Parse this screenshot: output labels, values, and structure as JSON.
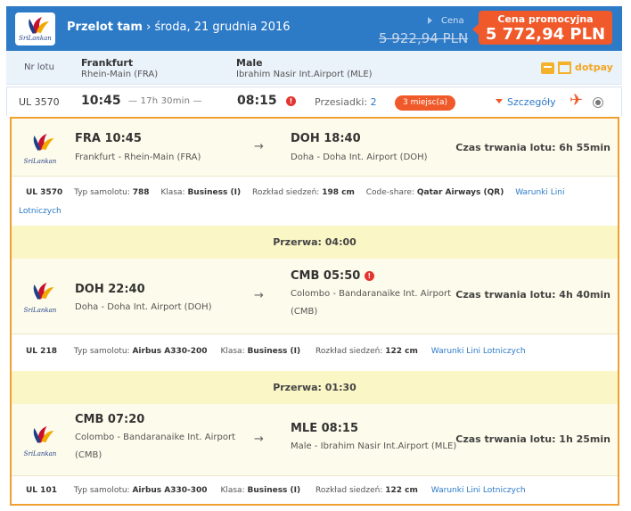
{
  "header": {
    "logo_text": "SriLankan",
    "title_bold": "Przelot tam",
    "title_rest": " › środa, 21 grudnia 2016",
    "price_label": "Cena",
    "old_price": "5 922,94 PLN",
    "promo_label": "Cena promocyjna",
    "promo_price": "5 772,94 PLN"
  },
  "route": {
    "flight_no_label": "Nr lotu",
    "from_city": "Frankfurt",
    "from_airport": "Rhein-Main (FRA)",
    "to_city": "Male",
    "to_airport": "Ibrahim Nasir Int.Airport (MLE)",
    "payment_text": "dotpay"
  },
  "summary": {
    "flight_no": "UL 3570",
    "departure": "10:45",
    "duration": "— 17h 30min —",
    "arrival": "08:15",
    "transfers_label": "Przesiadki:",
    "transfers_value": "2",
    "seats": "3 miejsc(a)",
    "details_link": "Szczegóły"
  },
  "segments": [
    {
      "logo_text": "SriLankan",
      "dep": "FRA 10:45",
      "dep_airport": "Frankfurt - Rhein-Main (FRA)",
      "arr": "DOH 18:40",
      "arr_airport": "Doha - Doha Int. Airport (DOH)",
      "duration": "Czas trwania lotu: 6h 55min",
      "info": {
        "flight_no": "UL 3570",
        "aircraft_label": "Typ samolotu:",
        "aircraft": "788",
        "class_label": "Klasa:",
        "class": "Business (I)",
        "pitch_label": "Rozkład siedzeń:",
        "pitch": "198 cm",
        "codeshare_label": "Code-share:",
        "codeshare": "Qatar Airways (QR)",
        "terms_link_a": "Warunki Lini",
        "terms_link_b": "Lotniczych"
      }
    },
    {
      "logo_text": "SriLankan",
      "dep": "DOH 22:40",
      "dep_airport": "Doha - Doha Int. Airport (DOH)",
      "arr": "CMB 05:50",
      "arr_airport_a": "Colombo - Bandaranaike Int. Airport",
      "arr_airport_b": "(CMB)",
      "duration": "Czas trwania lotu: 4h 40min",
      "info": {
        "flight_no": "UL 218",
        "aircraft_label": "Typ samolotu:",
        "aircraft": "Airbus A330-200",
        "class_label": "Klasa:",
        "class": "Business (I)",
        "pitch_label": "Rozkład siedzeń:",
        "pitch": "122 cm",
        "terms_link": "Warunki Lini Lotniczych"
      }
    },
    {
      "logo_text": "SriLankan",
      "dep": "CMB 07:20",
      "dep_airport_a": "Colombo - Bandaranaike Int. Airport",
      "dep_airport_b": "(CMB)",
      "arr": "MLE 08:15",
      "arr_airport": "Male - Ibrahim Nasir Int.Airport (MLE)",
      "duration": "Czas trwania lotu: 1h 25min",
      "info": {
        "flight_no": "UL 101",
        "aircraft_label": "Typ samolotu:",
        "aircraft": "Airbus A330-300",
        "class_label": "Klasa:",
        "class": "Business (I)",
        "pitch_label": "Rozkład siedzeń:",
        "pitch": "122 cm",
        "terms_link": "Warunki Lini Lotniczych"
      }
    }
  ],
  "breaks": [
    "Przerwa: 04:00",
    "Przerwa: 01:30"
  ],
  "icons": {
    "arrow": "→",
    "plane": "✈",
    "warning": "!"
  },
  "colors": {
    "header_blue": "#2d7ac7",
    "promo_orange": "#f0592a",
    "panel_border": "#f0a030",
    "link_blue": "#2d7ac7"
  }
}
